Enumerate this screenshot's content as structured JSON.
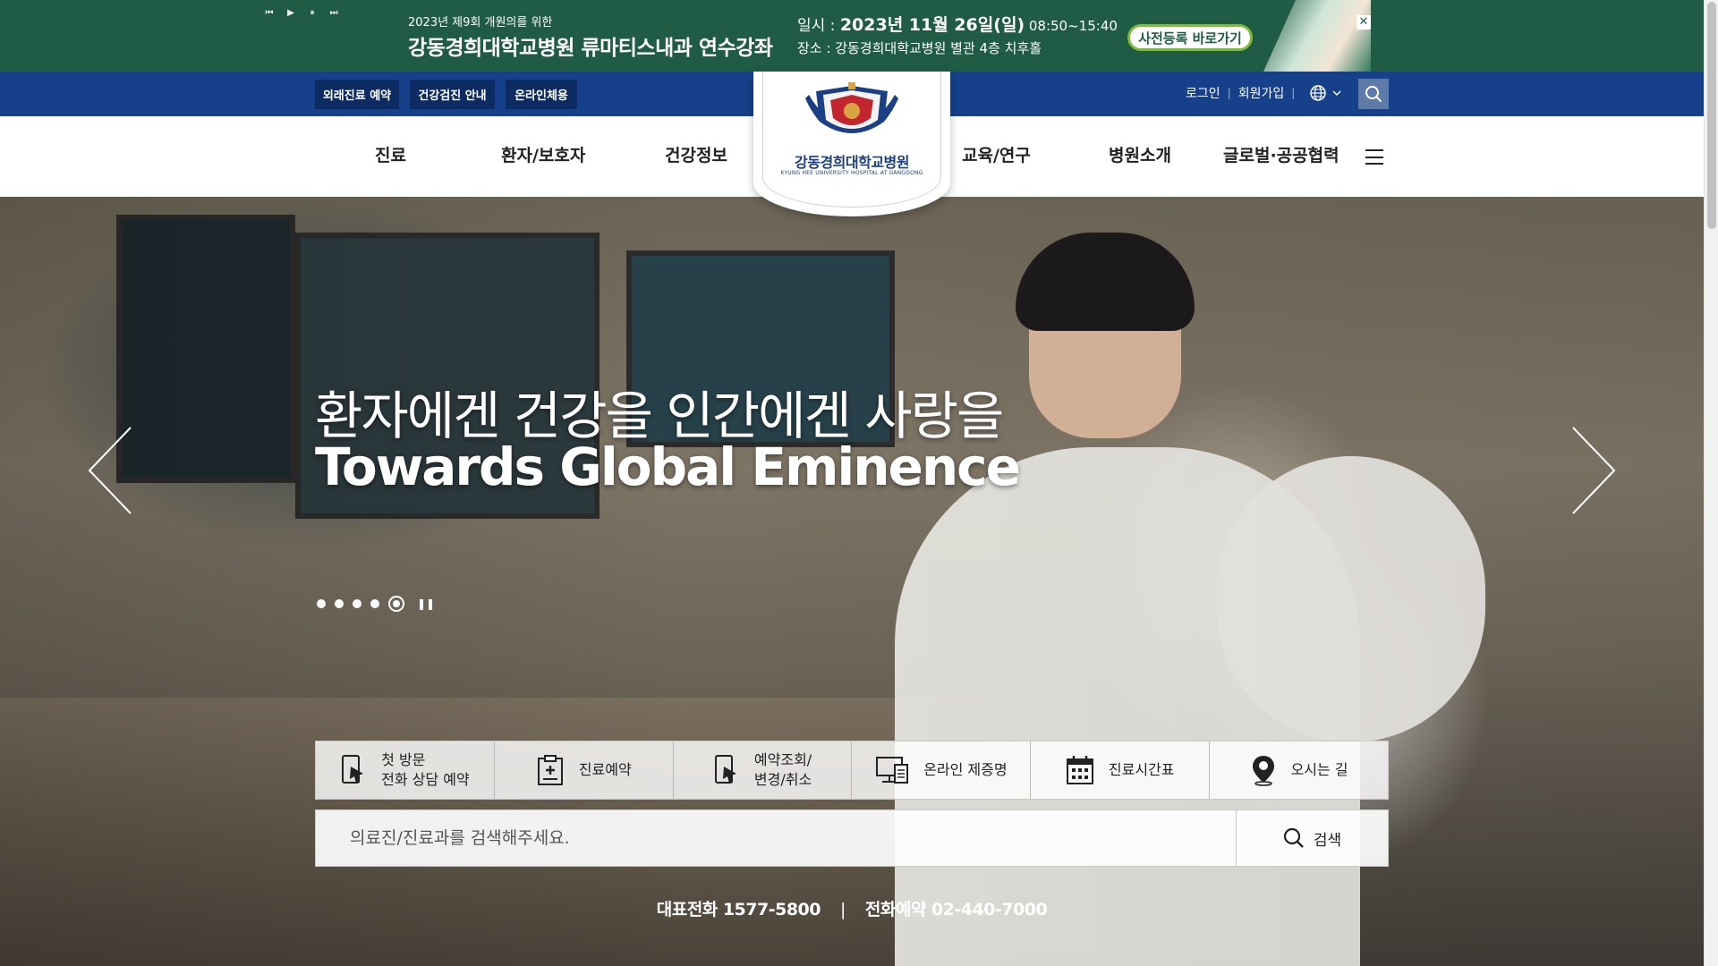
{
  "promo": {
    "controls": [
      "⏮",
      "▶",
      "⏸",
      "⏭"
    ],
    "subtitle": "2023년 제9회 개원의를 위한",
    "title": "강동경희대학교병원 류마티스내과 연수강좌",
    "date_label": "일시 : ",
    "date_value": "2023년 11월 26일(일)",
    "time_value": " 08:50~15:40",
    "place": "장소 : 강동경희대학교병원 별관 4층 치후홀",
    "register_button": "사전등록 바로가기",
    "close": "✕",
    "color": "#1f5b45"
  },
  "utility": {
    "quick_links": [
      "외래진료 예약",
      "건강검진 안내",
      "온라인체용"
    ],
    "login": "로그인",
    "join": "회원가입",
    "separator": "|",
    "color": "#16418a"
  },
  "logo": {
    "name": "강동경희대학교병원",
    "english": "KYUNG HEE UNIVERSITY HOSPITAL AT GANGDONG"
  },
  "nav": {
    "items": [
      "진료",
      "환자/보호자",
      "건강정보",
      "교육/연구",
      "병원소개",
      "글로벌·공공협력"
    ]
  },
  "hero": {
    "headline_kr": "환자에겐 건강을 인간에겐 사랑을",
    "headline_en": "Towards Global Eminence",
    "slide_count": 5,
    "active_slide": 5
  },
  "quick_menu": [
    {
      "label": "첫 방문\n전화 상담 예약",
      "icon": "phone-doc-icon"
    },
    {
      "label": "진료예약",
      "icon": "clipboard-plus-icon"
    },
    {
      "label": "예약조회/\n변경/취소",
      "icon": "phone-check-icon"
    },
    {
      "label": "온라인 제증명",
      "icon": "computer-doc-icon"
    },
    {
      "label": "진료시간표",
      "icon": "calendar-icon"
    },
    {
      "label": "오시는 길",
      "icon": "location-pin-icon"
    }
  ],
  "search": {
    "placeholder": "의료진/진료과를 검색해주세요.",
    "button": "검색"
  },
  "phones": {
    "main": "대표전화 1577-5800",
    "separator": "|",
    "reservation": "전화예약 02-440-7000"
  }
}
